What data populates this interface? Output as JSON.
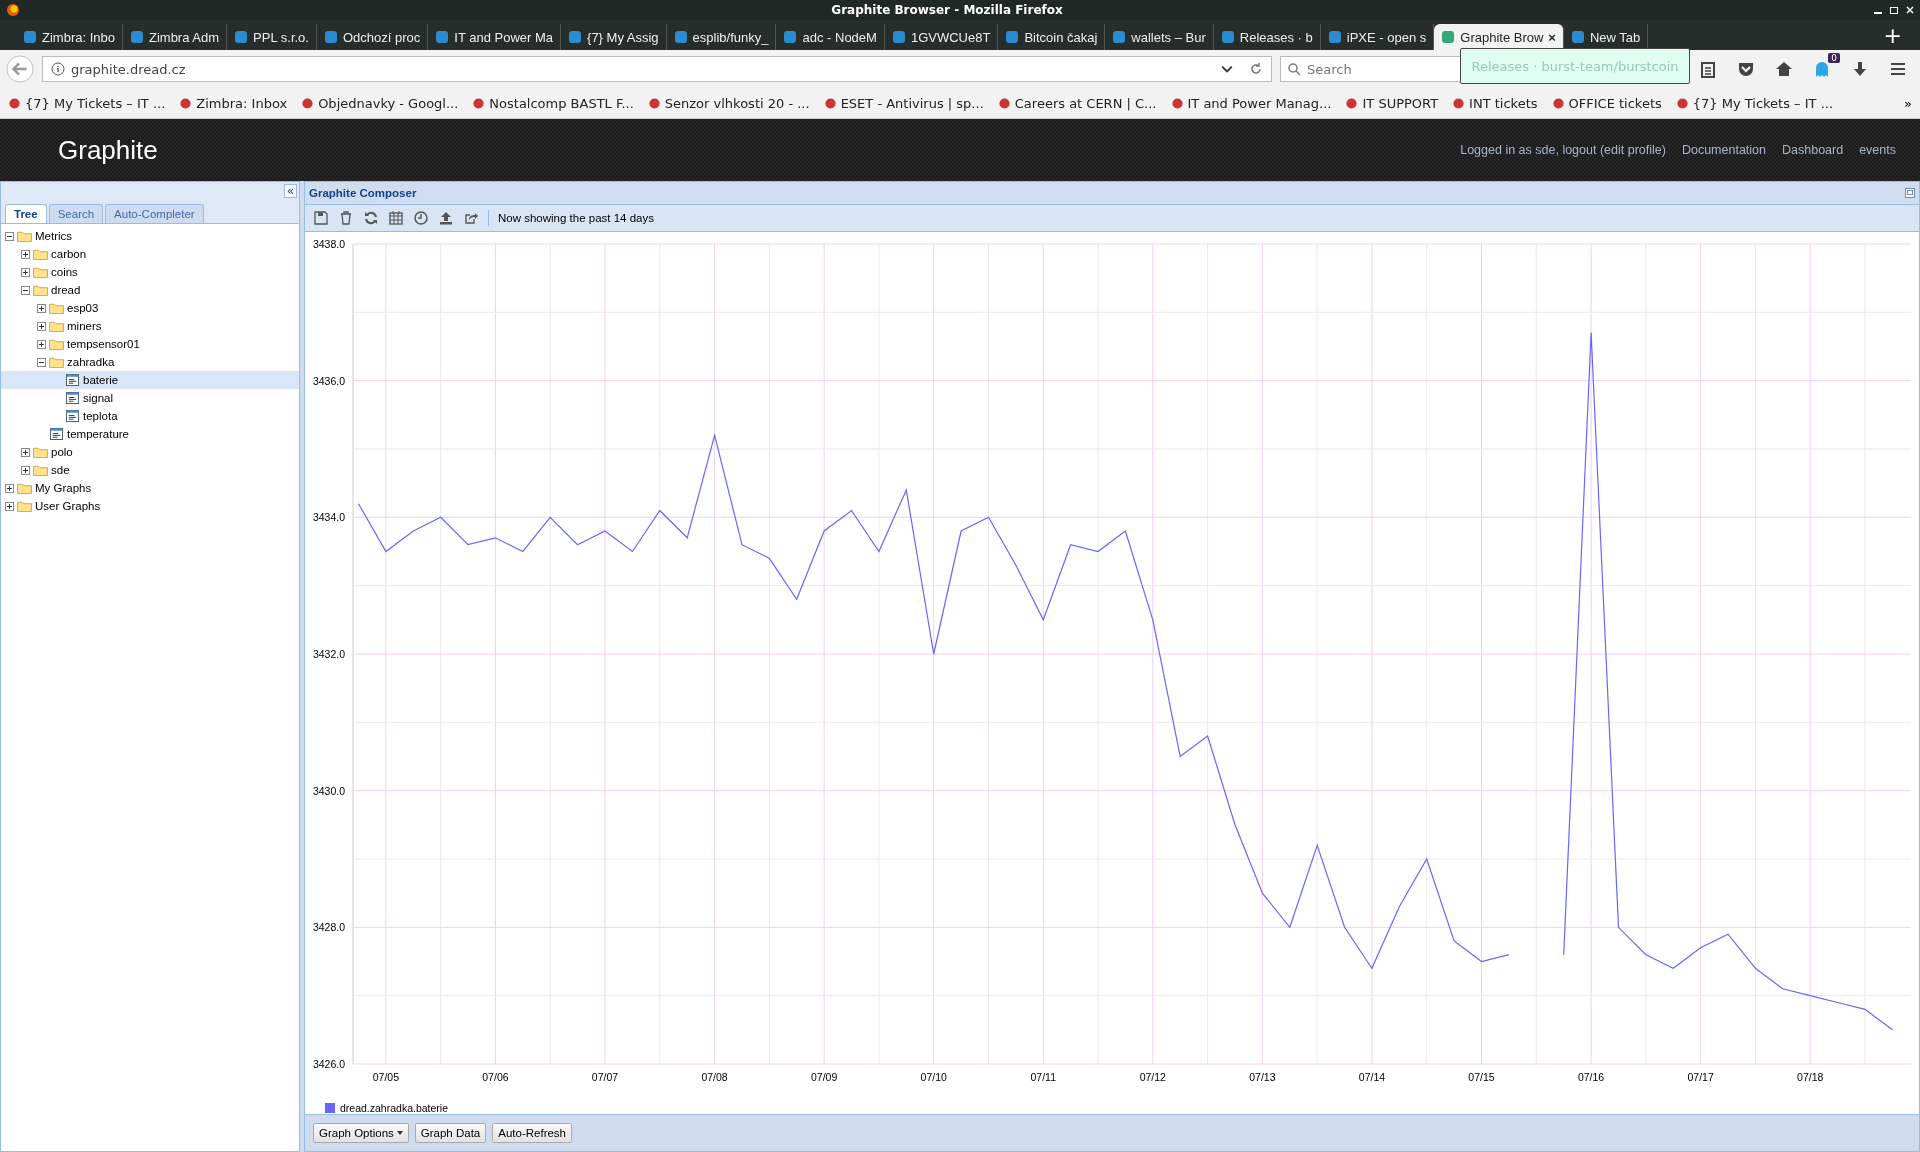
{
  "window": {
    "title": "Graphite Browser - Mozilla Firefox"
  },
  "tabs": [
    {
      "label": "Zimbra: Inbo",
      "selected": false
    },
    {
      "label": "Zimbra Adm",
      "selected": false
    },
    {
      "label": "PPL s.r.o.",
      "selected": false
    },
    {
      "label": "Odchozí proc",
      "selected": false
    },
    {
      "label": "IT and Power Ma",
      "selected": false
    },
    {
      "label": "{7} My Assig",
      "selected": false
    },
    {
      "label": "esplib/funky_",
      "selected": false
    },
    {
      "label": "adc - NodeM",
      "selected": false
    },
    {
      "label": "1GVWCUe8T",
      "selected": false
    },
    {
      "label": "Bitcoin čakaj",
      "selected": false
    },
    {
      "label": "wallets – Bur",
      "selected": false
    },
    {
      "label": "Releases · b",
      "selected": false
    },
    {
      "label": "iPXE - open s",
      "selected": false
    },
    {
      "label": "Graphite Brow",
      "selected": true,
      "close": "×"
    },
    {
      "label": "New Tab",
      "selected": false
    }
  ],
  "new_tab": "+",
  "tooltip": "Releases · burst-team/burstcoin",
  "address_bar": {
    "url": "graphite.dread.cz"
  },
  "search": {
    "placeholder": "Search"
  },
  "notification_badge": "0",
  "bookmarks": [
    "{7} My Tickets – IT ...",
    "Zimbra: Inbox",
    "Objednavky - Googl...",
    "Nostalcomp BASTL F...",
    "Senzor vlhkosti 20 - ...",
    "ESET - Antivirus | sp...",
    "Careers at CERN | C...",
    "IT and Power Manag...",
    "IT SUPPORT",
    "INT tickets",
    "OFFICE tickets",
    "{7} My Tickets – IT ..."
  ],
  "bookmarks_more": "»",
  "header": {
    "logo": "Graphite",
    "links": [
      "Logged in as sde, logout (edit profile)",
      "Documentation",
      "Dashboard",
      "events"
    ]
  },
  "sidebar": {
    "collapse": "«",
    "tabs": [
      {
        "label": "Tree",
        "selected": true
      },
      {
        "label": "Search",
        "selected": false
      },
      {
        "label": "Auto-Completer",
        "selected": false
      }
    ],
    "tree": [
      {
        "label": "Metrics",
        "kind": "folder",
        "expanded": true,
        "selected": false,
        "children": [
          {
            "label": "carbon",
            "kind": "folder",
            "expanded": false,
            "selected": false
          },
          {
            "label": "coins",
            "kind": "folder",
            "expanded": false,
            "selected": false
          },
          {
            "label": "dread",
            "kind": "folder",
            "expanded": true,
            "selected": false,
            "children": [
              {
                "label": "esp03",
                "kind": "folder",
                "expanded": false,
                "selected": false
              },
              {
                "label": "miners",
                "kind": "folder",
                "expanded": false,
                "selected": false
              },
              {
                "label": "tempsensor01",
                "kind": "folder",
                "expanded": false,
                "selected": false
              },
              {
                "label": "zahradka",
                "kind": "folder",
                "expanded": true,
                "selected": false,
                "children": [
                  {
                    "label": "baterie",
                    "kind": "leaf",
                    "selected": true
                  },
                  {
                    "label": "signal",
                    "kind": "leaf",
                    "selected": false
                  },
                  {
                    "label": "teplota",
                    "kind": "leaf",
                    "selected": false
                  }
                ]
              },
              {
                "label": "temperature",
                "kind": "leaf",
                "selected": false
              }
            ]
          },
          {
            "label": "polo",
            "kind": "folder",
            "expanded": false,
            "selected": false
          },
          {
            "label": "sde",
            "kind": "folder",
            "expanded": false,
            "selected": false
          }
        ]
      },
      {
        "label": "My Graphs",
        "kind": "folder",
        "expanded": false,
        "selected": false
      },
      {
        "label": "User Graphs",
        "kind": "folder",
        "expanded": false,
        "selected": false
      }
    ]
  },
  "composer": {
    "title": "Graphite Composer",
    "status": "Now showing the past 14 days",
    "chart_data": {
      "type": "line",
      "categories": [
        null,
        "07/05",
        null,
        null,
        null,
        "07/06",
        null,
        null,
        null,
        "07/07",
        null,
        null,
        null,
        "07/08",
        null,
        null,
        null,
        "07/09",
        null,
        null,
        null,
        "07/10",
        null,
        null,
        null,
        "07/11",
        null,
        null,
        null,
        "07/12",
        null,
        null,
        null,
        "07/13",
        null,
        null,
        null,
        "07/14",
        null,
        null,
        null,
        "07/15",
        null,
        null,
        null,
        "07/16",
        null,
        null,
        null,
        "07/17",
        null,
        null,
        null,
        "07/18",
        null,
        null,
        null
      ],
      "series": [
        {
          "name": "dread.zahradka.baterie",
          "color": "#6666ff",
          "values": [
            3434.2,
            3433.5,
            3433.8,
            3434.0,
            3433.6,
            3433.7,
            3433.5,
            3434.0,
            3433.6,
            3433.8,
            3433.5,
            3434.1,
            3433.7,
            3435.2,
            3433.6,
            3433.4,
            3432.8,
            3433.8,
            3434.1,
            3433.5,
            3434.4,
            3432.0,
            3433.8,
            3434.0,
            3433.3,
            3432.5,
            3433.6,
            3433.5,
            3433.8,
            3432.5,
            3430.5,
            3430.8,
            3429.5,
            3428.5,
            3428.0,
            3429.2,
            3428.0,
            3427.4,
            3428.3,
            3429.0,
            3427.8,
            3427.5,
            3427.6,
            null,
            3427.6,
            3436.7,
            3428.0,
            3427.6,
            3427.4,
            3427.7,
            3427.9,
            3427.4,
            3427.1,
            3427.0,
            3426.9,
            3426.8,
            3426.5
          ]
        }
      ],
      "ylim": [
        3426,
        3438
      ],
      "grid": true,
      "yticks": [
        {
          "value": 3426,
          "label": "3426.0"
        },
        {
          "value": 3428,
          "label": "3428.0"
        },
        {
          "value": 3430,
          "label": "3430.0"
        },
        {
          "value": 3432,
          "label": "3432.0"
        },
        {
          "value": 3434,
          "label": "3434.0"
        },
        {
          "value": 3436,
          "label": "3436.0"
        },
        {
          "value": 3438,
          "label": "3438.0"
        }
      ]
    },
    "buttons": [
      {
        "label": "Graph Options",
        "dropdown": true
      },
      {
        "label": "Graph Data",
        "dropdown": false
      },
      {
        "label": "Auto-Refresh",
        "dropdown": false
      }
    ]
  }
}
